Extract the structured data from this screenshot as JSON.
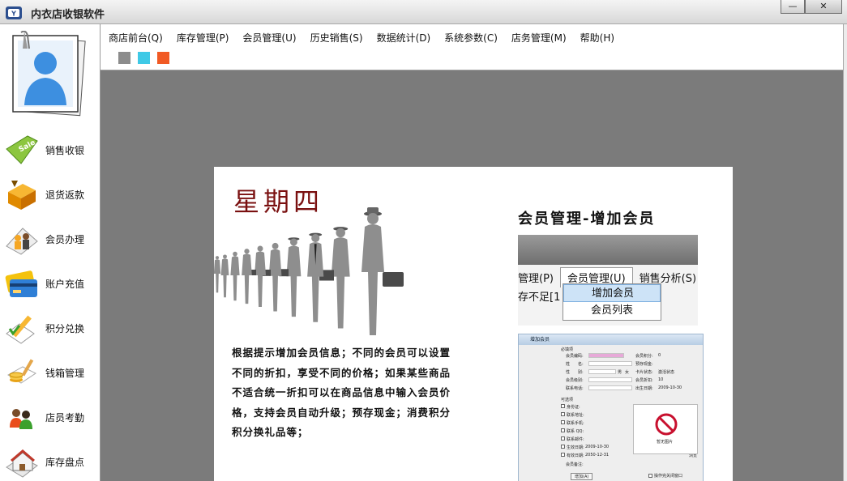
{
  "window": {
    "title": "内衣店收银软件",
    "minimize_glyph": "—",
    "close_glyph": "✕"
  },
  "sidebar": {
    "items": [
      {
        "label": "销售收银",
        "icon": "sale-tag-icon"
      },
      {
        "label": "退货返款",
        "icon": "return-box-icon"
      },
      {
        "label": "会员办理",
        "icon": "members-group-icon"
      },
      {
        "label": "账户充值",
        "icon": "credit-card-icon"
      },
      {
        "label": "积分兑换",
        "icon": "pencil-document-icon"
      },
      {
        "label": "钱箱管理",
        "icon": "coin-stack-icon"
      },
      {
        "label": "店员考勤",
        "icon": "staff-people-icon"
      },
      {
        "label": "库存盘点",
        "icon": "warehouse-icon"
      }
    ]
  },
  "menu": {
    "items": [
      "商店前台(Q)",
      "库存管理(P)",
      "会员管理(U)",
      "历史销售(S)",
      "数据统计(D)",
      "系统参数(C)",
      "店务管理(M)",
      "帮助(H)"
    ],
    "theme_colors": [
      "#8c8c8c",
      "#3fc9e6",
      "#f15a24"
    ]
  },
  "promo": {
    "weekday": "星期四",
    "description": "根据提示增加会员信息；不同的会员可以设置不同的折扣，享受不同的价格；如果某些商品不适合统一折扣可以在商品信息中输入会员价格，支持会员自动升级；预存现金；消费积分积分换礼品等；",
    "screenshot_title": "会员管理-增加会员",
    "menu_excerpt": {
      "items": [
        "管理(P)",
        "会员管理(U)",
        "销售分析(S)"
      ],
      "status_text": "存不足[1",
      "dropdown": [
        "增加会员",
        "会员列表"
      ]
    },
    "form_excerpt": {
      "window_title": "增加会员",
      "section_required": "必填项",
      "section_optional": "可选项",
      "fields_left": [
        "会员编码:",
        "姓　　名:",
        "性　　别:",
        "会员级别:",
        "联系电话:"
      ],
      "fields_right": [
        "会员积分:",
        "预存现金:",
        "卡片状态:",
        "会员折扣:",
        "出生日期:"
      ],
      "gender_options": [
        "男",
        "女"
      ],
      "card_status": "激活状态",
      "discount": "10",
      "birth_date": "2009-10-30",
      "optional_fields": [
        "身份证:",
        "联系地址:",
        "联系手机:",
        "联系 QQ:",
        "联系邮件:",
        "生效日期:",
        "有效日期:"
      ],
      "effective_date": "2009-10-30",
      "expire_date": "2050-12-31",
      "note_label": "会员备注:",
      "browse_label": "浏览",
      "save_label": "增加(A)",
      "close_after_label": "操作完关闭窗口",
      "photo_caption": "暂无图片",
      "points_value": "0"
    }
  }
}
